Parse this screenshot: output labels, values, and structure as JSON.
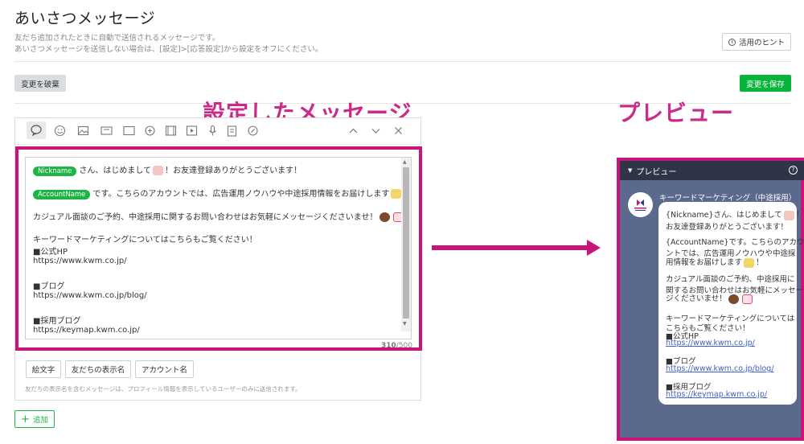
{
  "page": {
    "title": "あいさつメッセージ",
    "desc_line1": "友だち追加されたときに自動で送信されるメッセージです。",
    "desc_line2": "あいさつメッセージを送信しない場合は、[設定]>[応答設定]から設定をオフにください。",
    "hint_button": "活用のヒント",
    "discard_button": "変更を破棄",
    "save_button": "変更を保存"
  },
  "annotations": {
    "left_label": "設定したメッセージ",
    "right_label": "プレビュー"
  },
  "toolbar_icons": [
    "speech-bubble-icon",
    "emoji-icon",
    "image-icon",
    "card-icon",
    "stamp-icon",
    "video-icon",
    "play-icon",
    "mic-icon",
    "clipboard-icon",
    "compass-icon",
    "chevron-up-icon",
    "chevron-down-icon",
    "close-icon"
  ],
  "message": {
    "line1_tag": "Nickname",
    "line1_text": "さん、はじめまして",
    "line1_text2": "！お友達登録ありがとうございます！",
    "line2_tag": "AccountName",
    "line2_text": "です。こちらのアカウントでは、広告運用ノウハウや中途採用情報をお届けします",
    "line2_text2": "！",
    "line3_text": "カジュアル面談のご予約、中途採用に関するお問い合わせはお気軽にメッセージくださいませ！",
    "line4_text": "キーワードマーケティングについてはこちらもご覧ください！",
    "line5_text": "■公式HP",
    "line6_text": "https://www.kwm.co.jp/",
    "line7_text": "■ブログ",
    "line8_text": "https://www.kwm.co.jp/blog/",
    "line9_text": "■採用ブログ",
    "line10_text": "https://keymap.kwm.co.jp/"
  },
  "counter": {
    "current": "310",
    "max": "/500"
  },
  "chips": [
    "絵文字",
    "友だちの表示名",
    "アカウント名"
  ],
  "note": "友だちの表示名を含むメッセージは、プロフィール情報を表示しているユーザーのみに送信されます。",
  "add_button": "追加",
  "preview": {
    "header": "プレビュー",
    "sender": "キーワードマーケティング（中途採用）",
    "lines": [
      "{Nickname}さん、はじめまして",
      "お友達登録ありがとうございます！",
      "{AccountName}です。こちらのアカウ",
      "ントでは、広告運用ノウハウや中途採",
      "用情報をお届けします",
      "カジュアル面談のご予約、中途採用に",
      "関するお問い合わせはお気軽にメッセー",
      "ジくださいませ！",
      "キーワードマーケティングについては",
      "こちらもご覧ください！",
      "■公式HP",
      "https://www.kwm.co.jp/",
      "■ブログ",
      "https://www.kwm.co.jp/blog/",
      "■採用ブログ",
      "https://keymap.kwm.co.jp/"
    ],
    "excl1": "！",
    "excl2": "！"
  },
  "colors": {
    "accent": "#c8157b",
    "line_green": "#07b53b",
    "preview_bg": "#5b6a8c",
    "preview_header": "#2f3447"
  }
}
